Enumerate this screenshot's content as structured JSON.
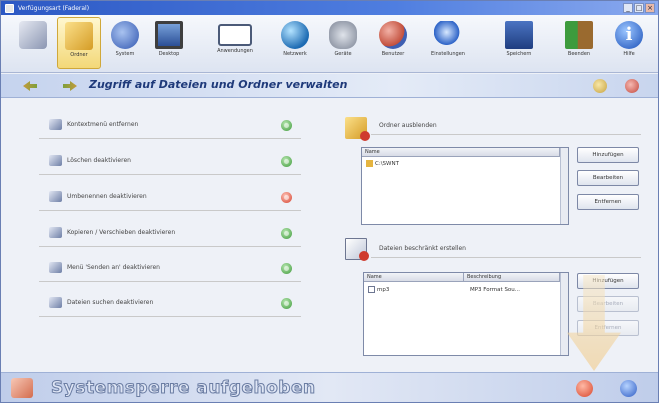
{
  "window": {
    "title": "Verfügungsart (Faderal)",
    "controls": [
      "_",
      "□",
      "×"
    ]
  },
  "toolbar": {
    "items": [
      {
        "label": "",
        "icon": "computer-icon"
      },
      {
        "label": "Ordner",
        "icon": "folder-icon",
        "active": true
      },
      {
        "label": "System",
        "icon": "system-icon"
      },
      {
        "label": "Desktop",
        "icon": "desktop-icon"
      },
      {
        "label": "Anwendungen",
        "icon": "window-icon"
      },
      {
        "label": "Netzwerk",
        "icon": "network-globe-icon"
      },
      {
        "label": "Geräte",
        "icon": "devices-icon"
      },
      {
        "label": "Benutzer",
        "icon": "users-icon"
      },
      {
        "label": "Einstellungen",
        "icon": "magnifier-icon"
      },
      {
        "label": "Speichern",
        "icon": "save-icon"
      },
      {
        "label": "Beenden",
        "icon": "exit-door-icon"
      },
      {
        "label": "Hilfe",
        "icon": "info-icon"
      }
    ]
  },
  "section": {
    "title": "Zugriff auf Dateien und Ordner verwalten"
  },
  "options": [
    {
      "label": "Kontextmenü entfernen",
      "status": "ok"
    },
    {
      "label": "Löschen deaktivieren",
      "status": "ok"
    },
    {
      "label": "Umbenennen deaktivieren",
      "status": "error"
    },
    {
      "label": "Kopieren / Verschieben deaktivieren",
      "status": "ok"
    },
    {
      "label": "Menü 'Senden an' deaktivieren",
      "status": "ok"
    },
    {
      "label": "Dateien suchen deaktivieren",
      "status": "ok"
    }
  ],
  "hide_folders": {
    "title": "Ordner ausblenden",
    "column": "Name",
    "rows": [
      "C:\\SWNT"
    ],
    "buttons": {
      "add": "Hinzufügen",
      "edit": "Bearbeiten",
      "remove": "Entfernen"
    }
  },
  "restrict_files": {
    "title": "Dateien beschränkt erstellen",
    "columns": [
      "Name",
      "Beschreibung"
    ],
    "rows": [
      {
        "name": "mp3",
        "description": "MP3 Format Sou..."
      }
    ],
    "buttons": {
      "add": "Hinzufügen",
      "edit": "Bearbeiten",
      "remove": "Entfernen"
    }
  },
  "statusbar": {
    "text": "Systemsperre aufgehoben"
  }
}
